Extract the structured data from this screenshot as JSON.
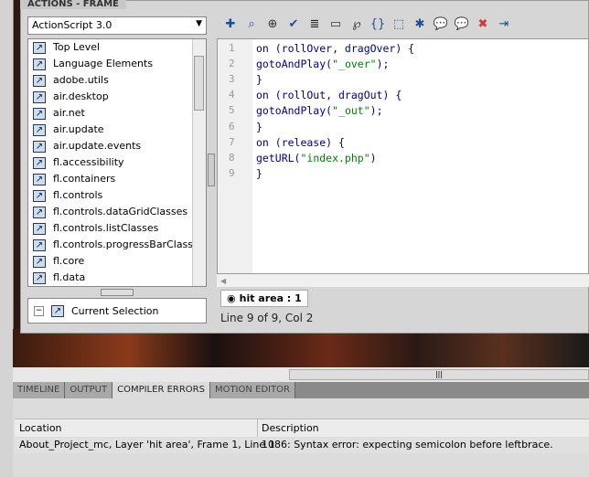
{
  "panel": {
    "title": "ACTIONS - FRAME",
    "language": "ActionScript 3.0"
  },
  "library": {
    "items": [
      "Top Level",
      "Language Elements",
      "adobe.utils",
      "air.desktop",
      "air.net",
      "air.update",
      "air.update.events",
      "fl.accessibility",
      "fl.containers",
      "fl.controls",
      "fl.controls.dataGridClasses",
      "fl.controls.listClasses",
      "fl.controls.progressBarClasses",
      "fl.core",
      "fl.data"
    ]
  },
  "current_selection": "Current Selection",
  "code": {
    "lines": [
      [
        {
          "t": "on (rollOver, dragOver) {"
        }
      ],
      [
        {
          "t": "gotoAndPlay("
        },
        {
          "t": "\"_over\"",
          "s": 1
        },
        {
          "t": ");"
        }
      ],
      [
        {
          "t": "}"
        }
      ],
      [
        {
          "t": "on (rollOut, dragOut) {"
        }
      ],
      [
        {
          "t": "gotoAndPlay("
        },
        {
          "t": "\"_out\"",
          "s": 1
        },
        {
          "t": ");"
        }
      ],
      [
        {
          "t": "}"
        }
      ],
      [
        {
          "t": "on (release) {"
        }
      ],
      [
        {
          "t": "getURL("
        },
        {
          "t": "\"index.php\"",
          "s": 1
        },
        {
          "t": ")"
        }
      ],
      [
        {
          "t": "}"
        }
      ]
    ]
  },
  "script_tab": "hit area : 1",
  "status": "Line 9 of 9, Col 2",
  "bottom_tabs": [
    "TIMELINE",
    "OUTPUT",
    "COMPILER ERRORS",
    "MOTION EDITOR"
  ],
  "active_tab": "COMPILER ERRORS",
  "errors": {
    "headers": {
      "location": "Location",
      "description": "Description"
    },
    "rows": [
      {
        "location": "About_Project_mc, Layer 'hit area', Frame 1, Line 1",
        "description": "1086: Syntax error: expecting semicolon before leftbrace."
      }
    ]
  },
  "toolbar_icons": [
    "add-icon",
    "find-icon",
    "target-icon",
    "check-syntax-icon",
    "auto-format-icon",
    "code-hint-icon",
    "debug-icon",
    "collapse-braces-icon",
    "collapse-selection-icon",
    "expand-all-icon",
    "block-comment-icon",
    "line-comment-icon",
    "remove-comment-icon",
    "script-assist-icon"
  ]
}
